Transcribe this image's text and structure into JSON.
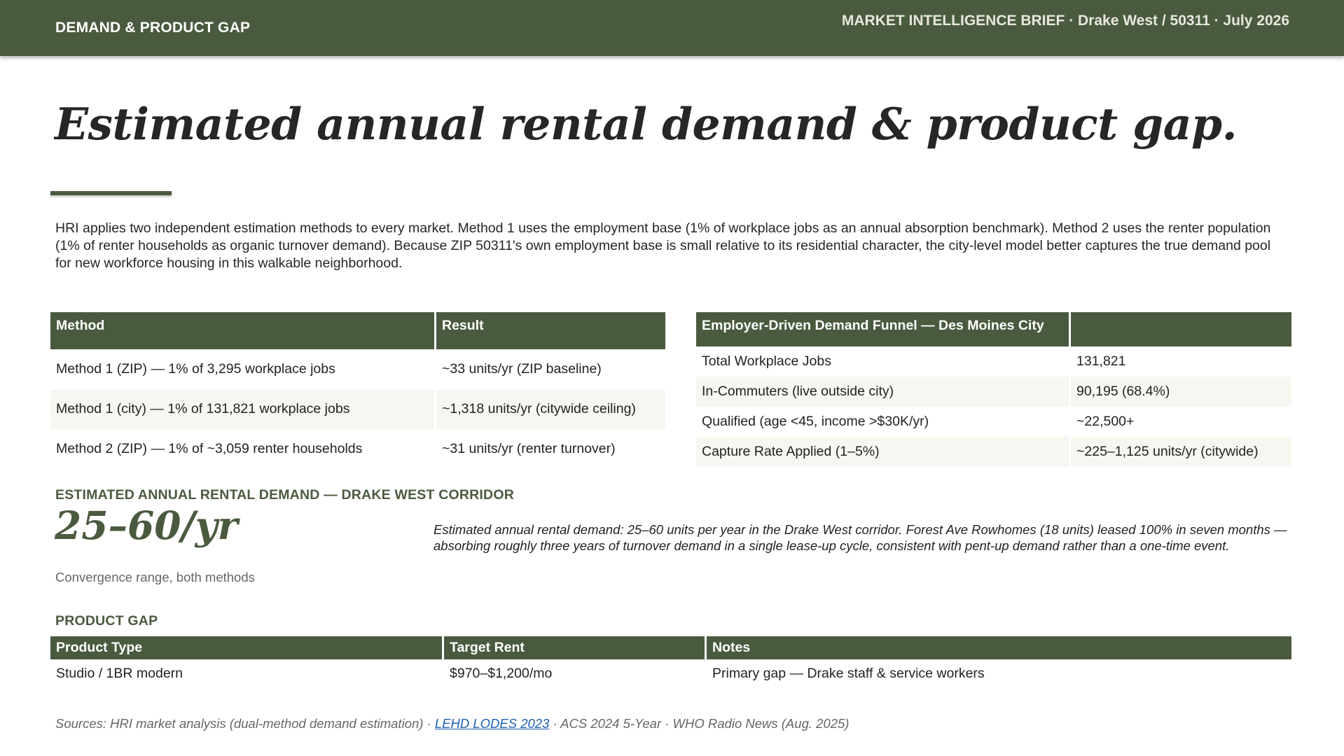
{
  "header": {
    "section": "DEMAND & PRODUCT GAP",
    "brief": "MARKET INTELLIGENCE BRIEF · Drake West / 50311 · July 2026"
  },
  "title": "Estimated annual rental demand & product gap.",
  "intro": "HRI applies two independent estimation methods to every market. Method 1 uses the employment base (1% of workplace jobs as an annual absorption benchmark). Method 2 uses the renter population (1% of renter households as organic turnover demand). Because ZIP 50311's own employment base is small relative to its residential character, the city-level model better captures the true demand pool for new workforce housing in this walkable neighborhood.",
  "methods_table": {
    "headers": [
      "Method",
      "Result"
    ],
    "rows": [
      [
        "Method 1 (ZIP) — 1% of 3,295 workplace jobs",
        "~33 units/yr (ZIP baseline)"
      ],
      [
        "Method 1 (city) — 1% of 131,821 workplace jobs",
        "~1,318 units/yr (citywide ceiling)"
      ],
      [
        "Method 2 (ZIP) — 1% of ~3,059 renter households",
        "~31 units/yr (renter turnover)"
      ]
    ]
  },
  "funnel_table": {
    "headers": [
      "Employer-Driven Demand Funnel — Des Moines City",
      ""
    ],
    "rows": [
      [
        "Total Workplace Jobs",
        "131,821"
      ],
      [
        "In-Commuters (live outside city)",
        "90,195 (68.4%)"
      ],
      [
        "Qualified (age <45, income >$30K/yr)",
        "~22,500+"
      ],
      [
        "Capture Rate Applied (1–5%)",
        "~225–1,125 units/yr (citywide)"
      ]
    ]
  },
  "demand": {
    "label": "ESTIMATED ANNUAL RENTAL DEMAND — DRAKE WEST CORRIDOR",
    "value": "25–60/yr",
    "caption": "Convergence range, both methods",
    "note": "Estimated annual rental demand: 25–60 units per year in the Drake West corridor. Forest Ave Rowhomes (18 units) leased 100% in seven months — absorbing roughly three years of turnover demand in a single lease-up cycle, consistent with pent-up demand rather than a one-time event."
  },
  "product_gap": {
    "label": "PRODUCT GAP",
    "headers": [
      "Product Type",
      "Target Rent",
      "Notes"
    ],
    "rows": [
      [
        "Studio / 1BR modern",
        "$970–$1,200/mo",
        "Primary gap — Drake staff & service workers"
      ]
    ]
  },
  "sources": {
    "prefix": "Sources: HRI market analysis (dual-method demand estimation) · ",
    "link": "LEHD LODES 2023",
    "suffix": " · ACS 2024 5-Year · WHO Radio News (Aug. 2025)"
  },
  "colors": {
    "accent": "#4a5a3f",
    "row_alt": "#f7f6f1",
    "link": "#1a5fb4"
  }
}
